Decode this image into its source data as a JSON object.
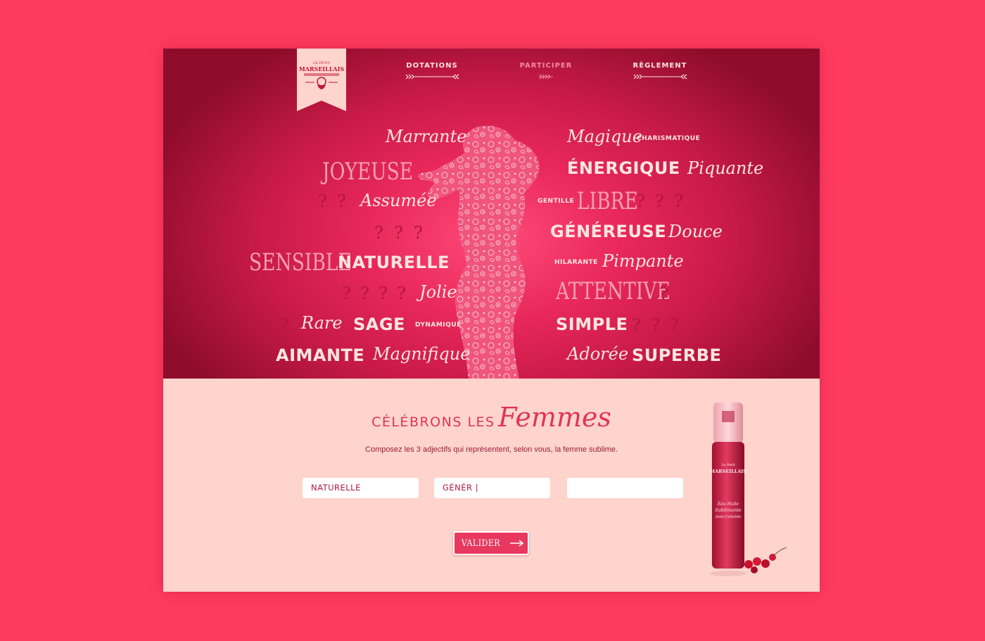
{
  "brand": {
    "logo_text_top": "LE PETIT",
    "logo_text_main": "MARSEILLAIS"
  },
  "nav": [
    {
      "label": "DOTATIONS",
      "active": false
    },
    {
      "label": "PARTICIPER",
      "active": true
    },
    {
      "label": "RÈGLEMENT",
      "active": false
    }
  ],
  "words": {
    "marrante": "Marrante",
    "magique": "Magique",
    "charismatique": "CHARISMATIQUE",
    "joyeuse": "JOYEUSE",
    "energique": "ÉNERGIQUE",
    "piquante": "Piquante",
    "assumee": "Assumée",
    "gentille": "GENTILLE",
    "libre": "LIBRE",
    "genereuse": "GÉNÉREUSE",
    "douce": "Douce",
    "sensible": "SENSIBLE",
    "naturelle": "NATURELLE",
    "hilarante": "HILARANTE",
    "pimpante": "Pimpante",
    "jolie": "Jolie",
    "attentive": "ATTENTIVE",
    "rare": "Rare",
    "sage": "SAGE",
    "dynamique": "DYNAMIQUE",
    "simple": "SIMPLE",
    "aimante": "AIMANTE",
    "magnifique": "Magnifique",
    "adoree": "Adorée",
    "superbe": "SUPERBE",
    "question": "?"
  },
  "form": {
    "title_part1": "CÉLÉBRONS LES",
    "title_part2": "Femmes",
    "subtitle": "Composez les 3 adjectifs qui représentent, selon vous, la femme sublime.",
    "field1_value": "NATURELLE",
    "field2_value": "GÉNÉR |",
    "field3_value": "",
    "submit_label": "VALIDER"
  },
  "product": {
    "label_line1": "Le Petit",
    "label_line2": "MARSEILLAIS",
    "label_line3": "Eau Huile",
    "label_line4": "Sublimante",
    "label_line5": "Anti-Cellulite"
  },
  "colors": {
    "page_bg": "#ff3a5f",
    "hero_accent": "#c81a48",
    "bottom_bg": "#ffd4cc",
    "button": "#e8385f"
  }
}
